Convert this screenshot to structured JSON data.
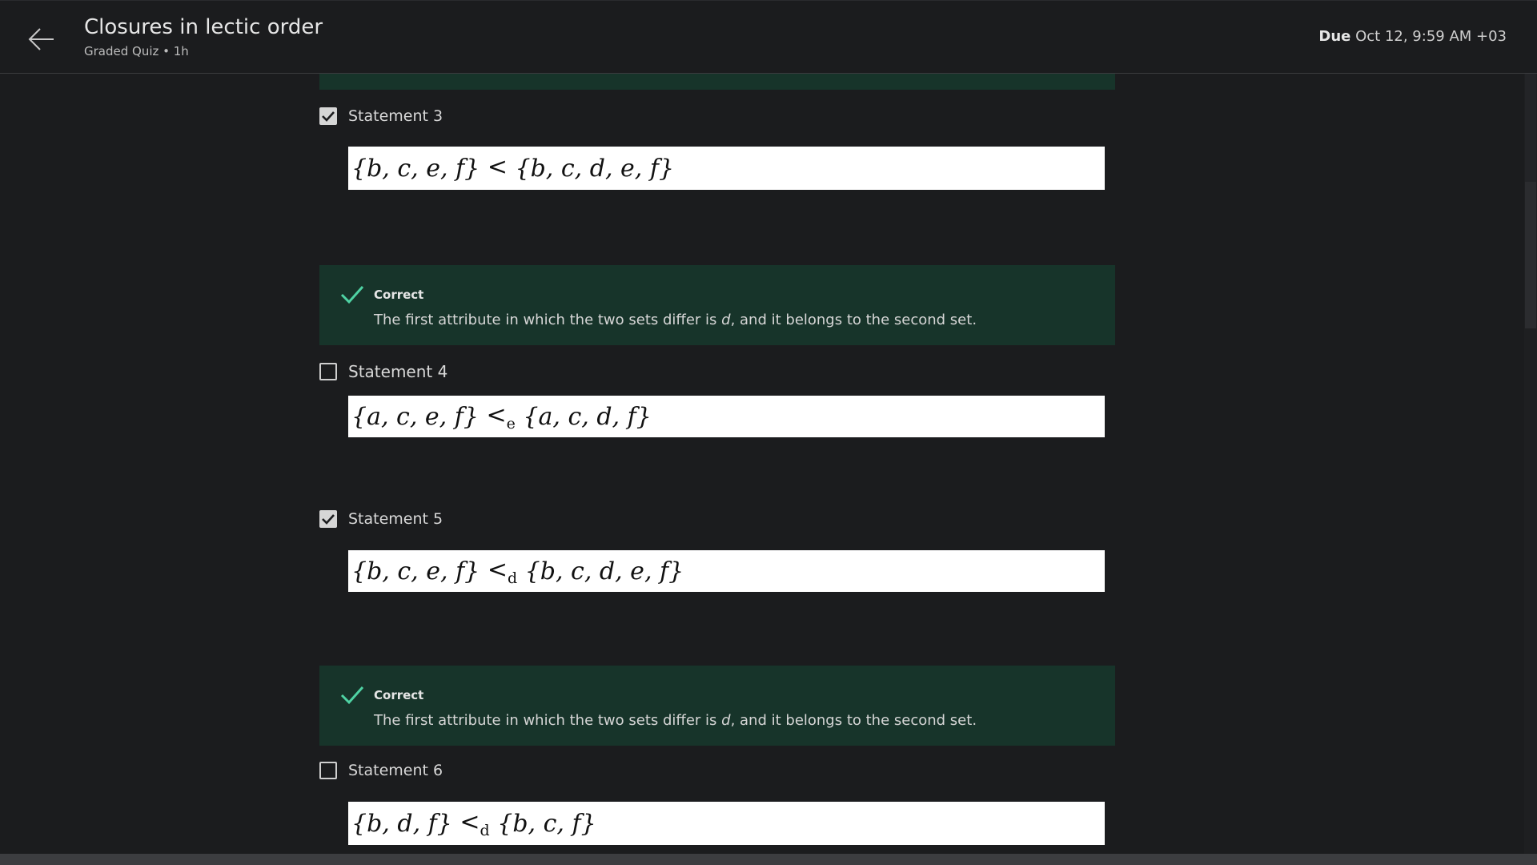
{
  "header": {
    "title": "Closures in lectic order",
    "subtitle": "Graded Quiz • 1h",
    "due_label": "Due",
    "due_value": "Oct 12, 9:59 AM +03"
  },
  "statements": [
    {
      "label": "Statement 3",
      "checked": true,
      "formula": {
        "left": "{b, c, e, f}",
        "op": "<",
        "sub": "",
        "right": "{b, c, d, e, f}"
      }
    },
    {
      "label": "Statement 4",
      "checked": false,
      "formula": {
        "left": "{a, c, e, f}",
        "op": "<",
        "sub": "e",
        "right": "{a, c, d, f}"
      }
    },
    {
      "label": "Statement 5",
      "checked": true,
      "formula": {
        "left": "{b, c, e, f}",
        "op": "<",
        "sub": "d",
        "right": "{b, c, d, e, f}"
      }
    },
    {
      "label": "Statement 6",
      "checked": false,
      "formula": {
        "left": "{b, d, f}",
        "op": "<",
        "sub": "d",
        "right": "{b, c, f}"
      }
    }
  ],
  "feedback": [
    {
      "title": "Correct",
      "text_before": "The first attribute in which the two sets differ is ",
      "text_var": "d",
      "text_after": ", and it belongs to the second set."
    },
    {
      "title": "Correct",
      "text_before": "The first attribute in which the two sets differ is ",
      "text_var": "d",
      "text_after": ", and it belongs to the second set."
    }
  ],
  "colors": {
    "background": "#1b1c1e",
    "feedback_bg": "#17342a",
    "check_accent": "#4fd3a4"
  },
  "icons": {
    "back": "arrow-left-icon",
    "correct": "checkmark-icon",
    "checkbox_checked": "check-icon"
  }
}
